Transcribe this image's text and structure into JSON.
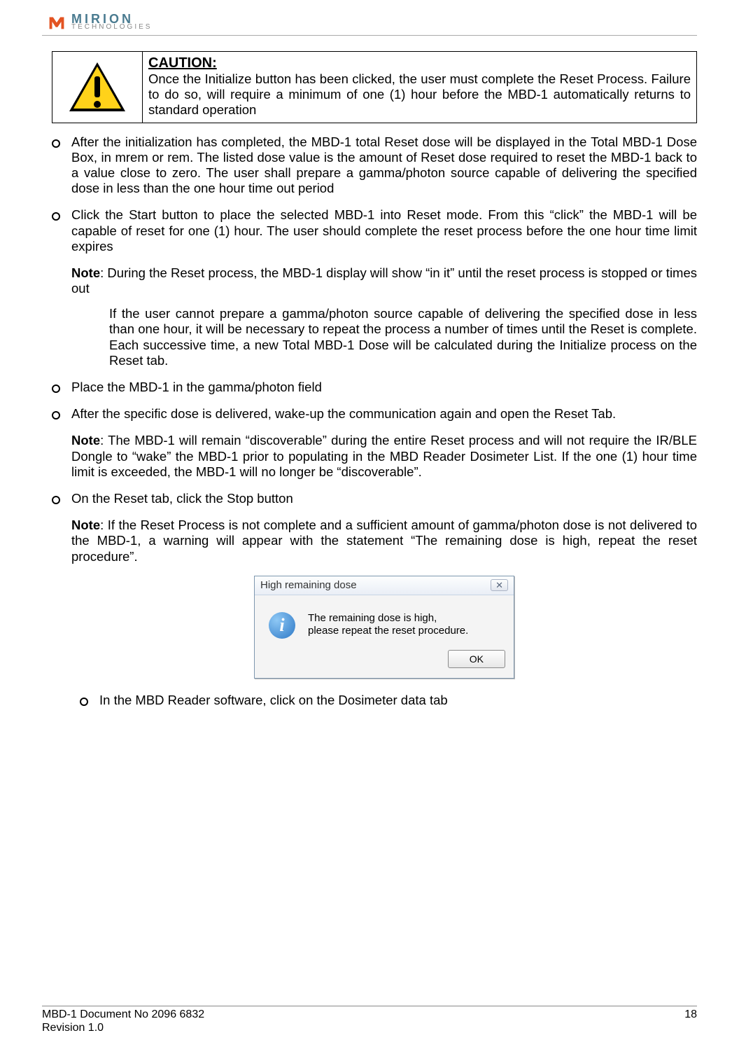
{
  "brand": {
    "name": "MIRION",
    "sub": "TECHNOLOGIES"
  },
  "caution": {
    "title": "CAUTION:",
    "body": "Once the Initialize button has been clicked, the user must complete the Reset Process. Failure to do so, will require a minimum of one (1) hour before the MBD-1 automatically returns to standard operation"
  },
  "items": {
    "i1": "After the initialization has completed, the MBD-1 total Reset dose will be displayed in the Total MBD-1 Dose Box, in mrem or rem. The listed dose value is the amount of Reset dose required to reset the MBD-1 back to a value close to zero. The user shall prepare a gamma/photon source capable of delivering the specified dose in less than the one hour time out period",
    "i2": "Click the Start button to place the selected MBD-1 into Reset mode. From this “click” the MBD-1 will be capable of reset for one (1) hour. The user should complete the reset process before the one hour time limit expires",
    "note2a_label": "Note",
    "note2a": ": During the Reset process, the MBD-1 display will show “in it” until the reset process is stopped or times out",
    "note2b": "If the user cannot prepare a gamma/photon source capable of delivering the specified dose in less than one hour, it will be necessary to repeat the process a number of times until the Reset is complete. Each successive time, a new Total MBD-1 Dose will be calculated during the Initialize process on the Reset tab.",
    "i3": "Place the MBD-1 in the gamma/photon field",
    "i4": "After the specific dose is delivered, wake-up the communication again and open the Reset Tab.",
    "note4_label": "Note",
    "note4": ": The MBD-1 will remain “discoverable” during the entire Reset process and will not require the IR/BLE Dongle to “wake” the MBD-1 prior to populating in the MBD Reader Dosimeter List. If the one (1) hour time limit is exceeded, the MBD-1 will no longer be “discoverable”.",
    "i5": "On the Reset tab, click the Stop button",
    "note5_label": "Note",
    "note5": ":   If the Reset Process is not complete and a sufficient amount of gamma/photon dose is not delivered to the MBD-1, a warning will appear with the statement “The remaining dose is high, repeat the reset procedure”.",
    "i6": "In the MBD Reader software, click on the Dosimeter data tab"
  },
  "dialog": {
    "title": "High remaining dose",
    "close": "✕",
    "line1": "The remaining dose is high,",
    "line2": "please repeat the reset procedure.",
    "ok": "OK"
  },
  "footer": {
    "doc": "MBD-1 Document No 2096 6832",
    "rev": "Revision 1.0",
    "page": "18"
  }
}
